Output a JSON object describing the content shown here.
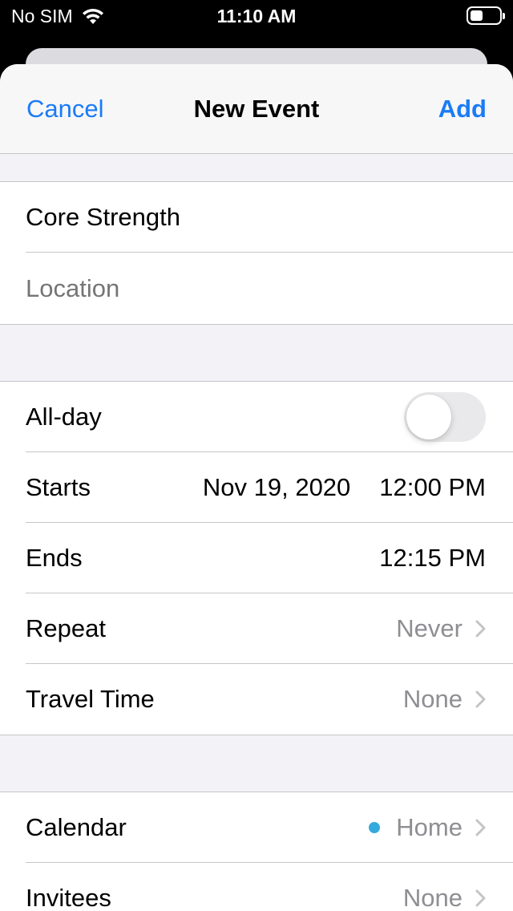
{
  "status_bar": {
    "carrier": "No SIM",
    "time": "11:10 AM",
    "battery_level": 0.45
  },
  "nav": {
    "cancel_label": "Cancel",
    "title": "New Event",
    "add_label": "Add"
  },
  "event": {
    "title_value": "Core Strength",
    "location_placeholder": "Location"
  },
  "timing": {
    "allday_label": "All-day",
    "allday_on": false,
    "starts_label": "Starts",
    "starts_date": "Nov 19, 2020",
    "starts_time": "12:00 PM",
    "ends_label": "Ends",
    "ends_time": "12:15 PM",
    "repeat_label": "Repeat",
    "repeat_value": "Never",
    "travel_label": "Travel Time",
    "travel_value": "None"
  },
  "details": {
    "calendar_label": "Calendar",
    "calendar_value": "Home",
    "calendar_color": "#34aadc",
    "invitees_label": "Invitees",
    "invitees_value": "None"
  },
  "colors": {
    "accent": "#1a7cf5",
    "secondary_text": "#8e8e93"
  }
}
